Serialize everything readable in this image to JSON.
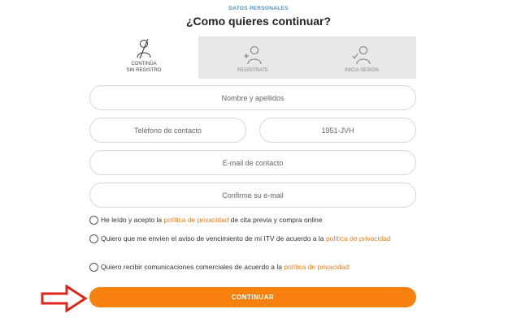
{
  "header": {
    "section_label": "DATOS PERSONALES",
    "title": "¿Como quieres continuar?"
  },
  "tabs": [
    {
      "label_line1": "CONTINÚA",
      "label_line2": "SIN REGISTRO",
      "active": true,
      "icon": "no-user-icon"
    },
    {
      "label_line1": "REGÍSTRATE",
      "label_line2": "",
      "active": false,
      "icon": "add-user-icon"
    },
    {
      "label_line1": "INICIA SESIÓN",
      "label_line2": "",
      "active": false,
      "icon": "login-user-icon"
    }
  ],
  "form": {
    "name_placeholder": "Nombre y apellidos",
    "phone_placeholder": "Teléfono de contacto",
    "plate_value": "1951-JVH",
    "email_placeholder": "E-mail de contacto",
    "email_confirm_placeholder": "Confirme su e-mail"
  },
  "checks": {
    "privacy": {
      "before": "He leído y acepto la ",
      "link": "política de privacidad",
      "after": " de cita previa y compra online"
    },
    "itv_notice": {
      "before": "Quiero que me envíen el aviso de vencimiento de mi ITV de acuerdo a la ",
      "link": "política de privacidad",
      "after": ""
    },
    "commercial": {
      "before": "Quiero recibir comunicaciones comerciales de acuerdo a la ",
      "link": "política de privacidad",
      "after": ""
    }
  },
  "actions": {
    "continue_label": "CONTINUAR"
  },
  "colors": {
    "accent": "#f7800f",
    "link": "#f07c1a",
    "arrow": "#e0251b",
    "tab_inactive": "#e8e8e8"
  }
}
